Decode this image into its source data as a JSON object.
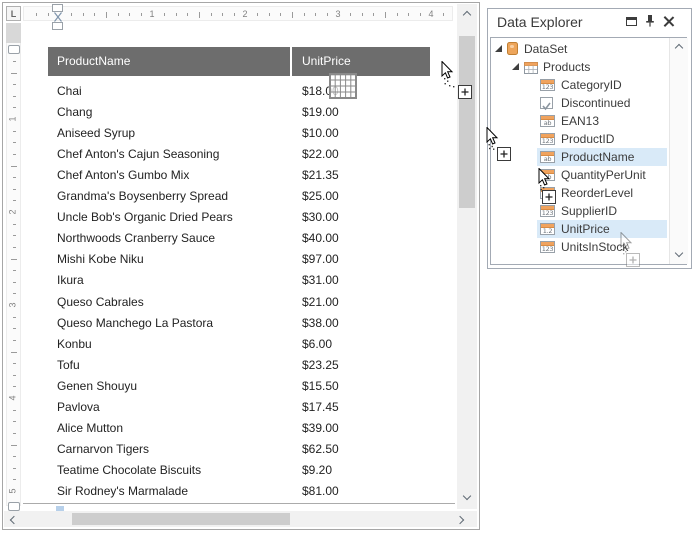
{
  "design_window": {
    "ruler_corner_label": "L",
    "h_ruler_numbers": [
      "1",
      "2",
      "3",
      "4"
    ],
    "v_ruler_numbers": [
      "1",
      "2",
      "3",
      "4",
      "5"
    ],
    "table": {
      "columns": [
        "ProductName",
        "UnitPrice"
      ],
      "rows": [
        {
          "name": "Chai",
          "price": "$18.00"
        },
        {
          "name": "Chang",
          "price": "$19.00"
        },
        {
          "name": "Aniseed Syrup",
          "price": "$10.00"
        },
        {
          "name": "Chef Anton's Cajun Seasoning",
          "price": "$22.00"
        },
        {
          "name": "Chef Anton's Gumbo Mix",
          "price": "$21.35"
        },
        {
          "name": "Grandma's Boysenberry Spread",
          "price": "$25.00"
        },
        {
          "name": "Uncle Bob's Organic Dried Pears",
          "price": "$30.00"
        },
        {
          "name": "Northwoods Cranberry Sauce",
          "price": "$40.00"
        },
        {
          "name": "Mishi Kobe Niku",
          "price": "$97.00"
        },
        {
          "name": "Ikura",
          "price": "$31.00"
        },
        {
          "name": "Queso Cabrales",
          "price": "$21.00"
        },
        {
          "name": "Queso Manchego La Pastora",
          "price": "$38.00"
        },
        {
          "name": "Konbu",
          "price": "$6.00"
        },
        {
          "name": "Tofu",
          "price": "$23.25"
        },
        {
          "name": "Genen Shouyu",
          "price": "$15.50"
        },
        {
          "name": "Pavlova",
          "price": "$17.45"
        },
        {
          "name": "Alice Mutton",
          "price": "$39.00"
        },
        {
          "name": "Carnarvon Tigers",
          "price": "$62.50"
        },
        {
          "name": "Teatime Chocolate Biscuits",
          "price": "$9.20"
        },
        {
          "name": "Sir Rodney's Marmalade",
          "price": "$81.00"
        }
      ]
    }
  },
  "panel": {
    "title": "Data Explorer",
    "window_icons": [
      "restore-window-icon",
      "pin-icon",
      "close-icon"
    ],
    "tree": [
      {
        "label": "DataSet",
        "icon": "database",
        "level": 0,
        "expanded": true
      },
      {
        "label": "Products",
        "icon": "table",
        "level": 1,
        "expanded": true
      },
      {
        "label": "CategoryID",
        "icon": "123",
        "level": 2
      },
      {
        "label": "Discontinued",
        "icon": "check",
        "level": 2
      },
      {
        "label": "EAN13",
        "icon": "ab",
        "level": 2
      },
      {
        "label": "ProductID",
        "icon": "123",
        "level": 2
      },
      {
        "label": "ProductName",
        "icon": "ab",
        "level": 2,
        "highlighted": true
      },
      {
        "label": "QuantityPerUnit",
        "icon": "ab",
        "level": 2
      },
      {
        "label": "ReorderLevel",
        "icon": "123",
        "level": 2
      },
      {
        "label": "SupplierID",
        "icon": "123",
        "level": 2
      },
      {
        "label": "UnitPrice",
        "icon": "1.2",
        "level": 2,
        "highlighted": true
      },
      {
        "label": "UnitsInStock",
        "icon": "123",
        "level": 2
      }
    ]
  },
  "colors": {
    "header_gray": "#6d6d6d",
    "accent_orange": "#f0a35e",
    "highlight_blue": "#d9eaf8"
  }
}
